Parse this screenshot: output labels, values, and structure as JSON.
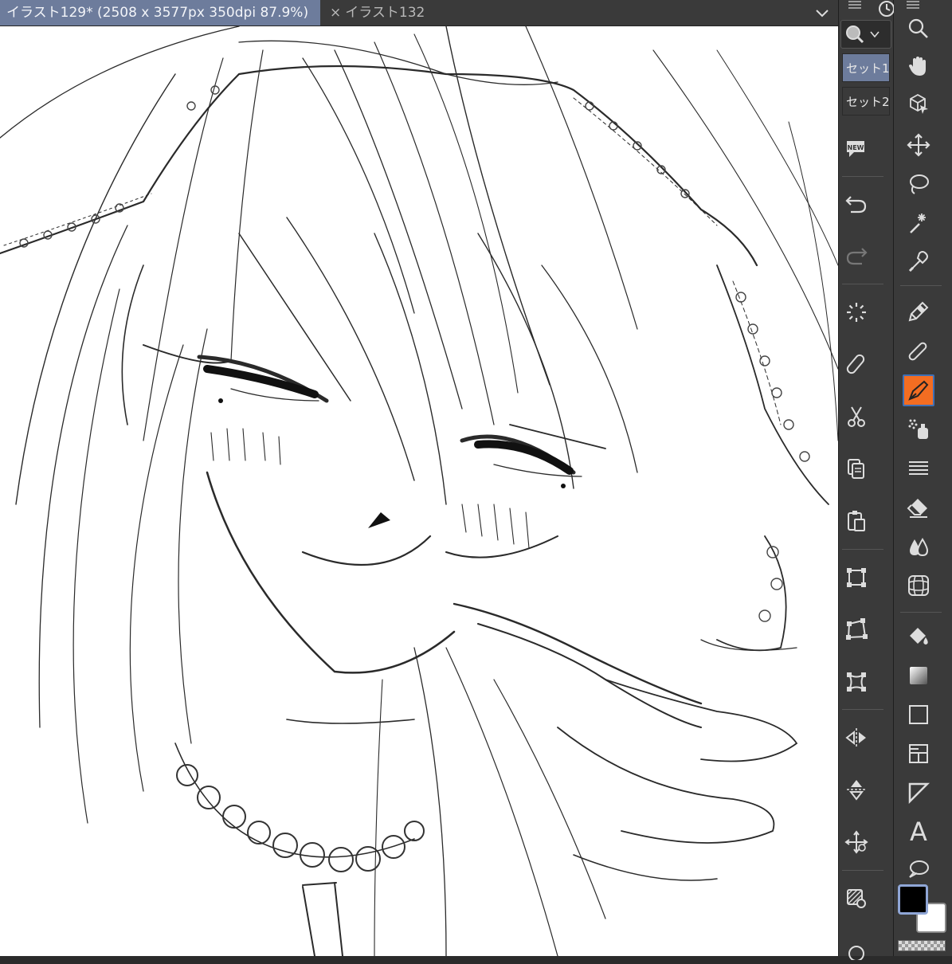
{
  "tabs": {
    "active": "イラスト129* (2508 x 3577px 350dpi 87.9%)",
    "inactive_close": "×",
    "inactive": "イラスト132"
  },
  "command_bar": {
    "sets": [
      "セット1",
      "セット2"
    ],
    "new_badge": "NEW",
    "icons": [
      "magnifier-icon",
      "new-icon",
      "undo-icon",
      "redo-icon",
      "loading-icon",
      "eraser-clear-icon",
      "cut-icon",
      "copy-icon",
      "paste-icon",
      "transform-icon",
      "free-transform-icon",
      "mesh-transform-icon",
      "flip-horizontal-icon",
      "flip-vertical-icon",
      "move-layer-icon",
      "layer-settings-icon"
    ]
  },
  "toolbar": {
    "icons": [
      "zoom-icon",
      "hand-icon",
      "object-select-icon",
      "move-icon",
      "lasso-icon",
      "auto-select-icon",
      "eyedropper-icon",
      "pen-icon",
      "pencil-icon",
      "brush-icon",
      "airbrush-icon",
      "decoration-icon",
      "eraser-icon",
      "blend-icon",
      "figure-icon",
      "fill-icon",
      "gradient-icon",
      "rectangle-icon",
      "frame-icon",
      "ruler-icon",
      "text-icon",
      "balloon-icon"
    ],
    "selected": "brush-icon",
    "text_tool_label": "A"
  },
  "colors": {
    "accent": "#6d7c9c",
    "selected_tool": "#f36d22",
    "foreground": "#000000",
    "background": "#ffffff"
  }
}
